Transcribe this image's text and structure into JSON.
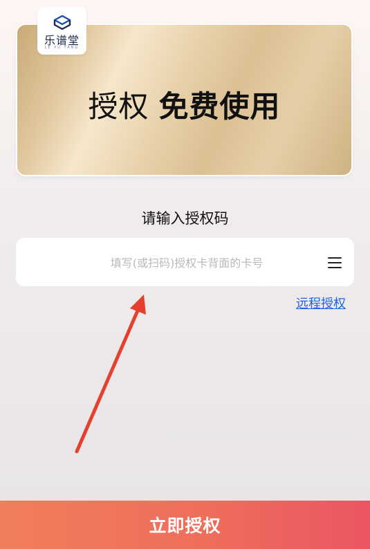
{
  "card": {
    "title_normal": "授权",
    "title_bold": "免费使用"
  },
  "logo": {
    "name": "乐谱堂",
    "subtitle": "LE PU TANG"
  },
  "form": {
    "prompt": "请输入授权码",
    "card_number": {
      "value": "",
      "placeholder": "填写(或扫码)授权卡背面的卡号"
    },
    "menu_icon": "menu-icon"
  },
  "links": {
    "remote_auth": "远程授权"
  },
  "actions": {
    "submit_label": "立即授权"
  },
  "colors": {
    "accent_start": "#f07e5a",
    "accent_end": "#eb5562",
    "link": "#1f63e8",
    "annotation_arrow": "#e53f2d"
  }
}
